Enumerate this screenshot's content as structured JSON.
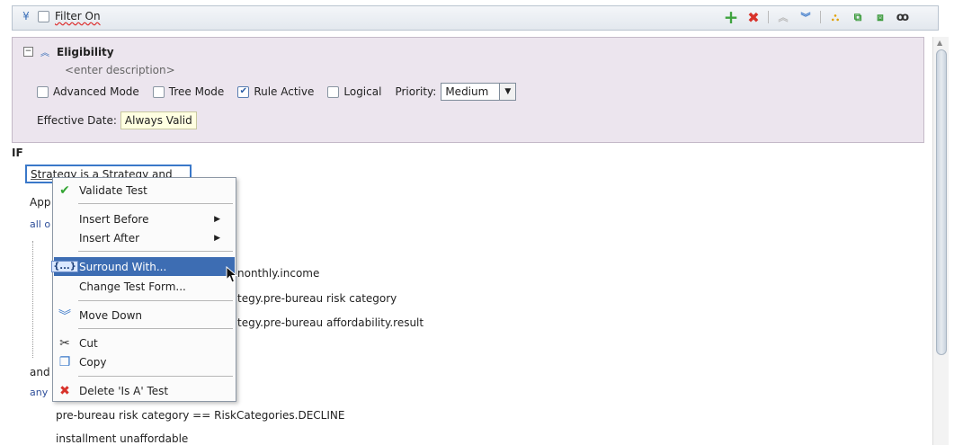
{
  "toolbar": {
    "filter_label": "Filter On",
    "filter_checked": false,
    "icons": [
      "add-icon",
      "delete-icon",
      "move-up-icon",
      "move-down-icon",
      "tree-icon",
      "split-icon",
      "merge-icon",
      "find-icon"
    ]
  },
  "rule": {
    "name": "Eligibility",
    "description": "<enter description>",
    "advanced_mode": "Advanced Mode",
    "tree_mode": "Tree Mode",
    "rule_active": "Rule Active",
    "logical": "Logical",
    "priority_label": "Priority:",
    "priority_value": "Medium",
    "effective_label": "Effective Date:",
    "effective_value": "Always Valid"
  },
  "body": {
    "if_label": "IF",
    "selected_test": "Strategy is a Strategy and",
    "line_app": "App",
    "line_all": "all o",
    "line_income": "nonthly.income",
    "line_risk": "tegy.pre-bureau risk category",
    "line_afford": "tegy.pre-bureau affordability.result",
    "line_and": "and",
    "line_any": "any",
    "line_decline": "pre-bureau risk category  ==  RiskCategories.DECLINE",
    "line_installment": "installment unaffordable"
  },
  "context_menu": {
    "validate": "Validate Test",
    "insert_before": "Insert Before",
    "insert_after": "Insert After",
    "surround": "Surround With...",
    "change_form": "Change Test Form...",
    "move_down": "Move Down",
    "cut": "Cut",
    "copy": "Copy",
    "delete": "Delete  'Is A' Test"
  }
}
